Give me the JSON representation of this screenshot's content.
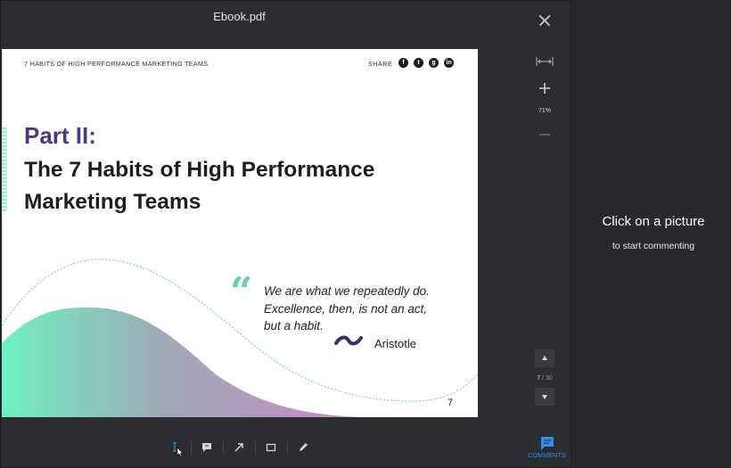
{
  "viewer": {
    "title": "Ebook.pdf",
    "zoom_level": "71%",
    "current_page": "7",
    "page_total": "/ 30",
    "comments_label": "COMMENTS"
  },
  "document": {
    "header_title": "7 HABITS OF HIGH PERFORMANCE MARKETING TEAMS",
    "share_label": "SHARE",
    "social_icons": [
      "facebook-icon",
      "twitter-icon",
      "google-plus-icon",
      "linkedin-icon"
    ],
    "part": "Part II:",
    "headline": "The 7 Habits of High Performance Marketing Teams",
    "quote": "We are what we repeatedly do. Excellence, then, is not an act, but a habit.",
    "author": "Aristotle",
    "page_number": "7",
    "colors": {
      "purple": "#4b3b7c",
      "mint": "#6fcfa5",
      "gradient_start": "#6ff0c0",
      "gradient_end": "#c78bc3"
    }
  },
  "toolbar": {
    "tools": [
      "text-tool-icon",
      "comment-tool-icon",
      "arrow-tool-icon",
      "rectangle-tool-icon",
      "pen-tool-icon"
    ],
    "active_color": "#2f8fe6"
  },
  "panel": {
    "title": "Click on a picture",
    "subtitle": "to start commenting"
  }
}
